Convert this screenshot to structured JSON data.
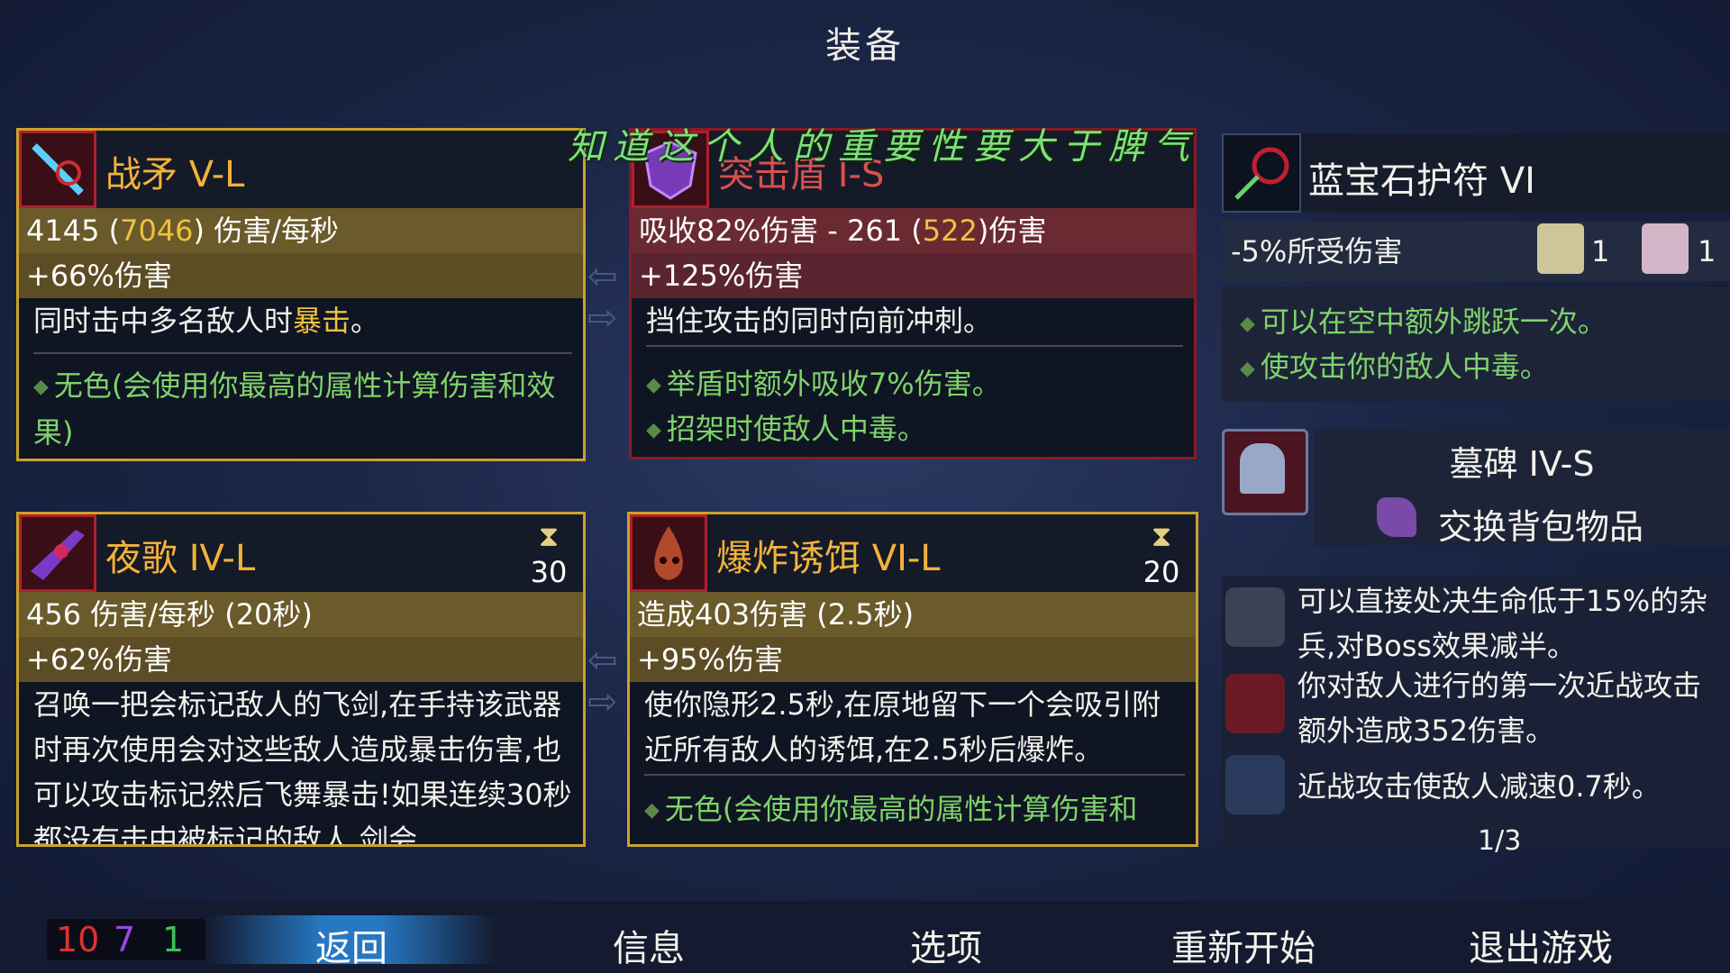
{
  "screen_title": "装备",
  "overlay_text": "知道这个人的重要性要大于脾气",
  "weapons": [
    {
      "name": "战矛 V-L",
      "stat1_a": "4145 (",
      "stat1_b": "7046",
      "stat1_c": ") 伤害/每秒",
      "stat2": "+66%伤害",
      "desc_a": "同时击中多名敌人时",
      "desc_b": "暴击",
      "desc_c": "。",
      "bonus": "无色(会使用你最高的属性计算伤害和效果)"
    },
    {
      "name": "突击盾 I-S",
      "stat1_a": "吸收82%伤害 - 261 (",
      "stat1_b": "522",
      "stat1_c": ")伤害",
      "stat2": "+125%伤害",
      "desc": "挡住攻击的同时向前冲刺。",
      "bonus1": "举盾时额外吸收7%伤害。",
      "bonus2": "招架时使敌人中毒。"
    }
  ],
  "skills": [
    {
      "name": "夜歌 IV-L",
      "cooldown": "30",
      "stat1": "456 伤害/每秒 (20秒)",
      "stat2": "+62%伤害",
      "desc": "召唤一把会标记敌人的飞剑,在手持该武器时再次使用会对这些敌人造成暴击伤害,也可以攻击标记然后飞舞暴击!如果连续30秒都没有击中被标记的敌人,剑会"
    },
    {
      "name": "爆炸诱饵 VI-L",
      "cooldown": "20",
      "stat1": "造成403伤害 (2.5秒)",
      "stat2": "+95%伤害",
      "desc": "使你隐形2.5秒,在原地留下一个会吸引附近所有敌人的诱饵,在2.5秒后爆炸。",
      "bonus": "无色(会使用你最高的属性计算伤害和"
    }
  ],
  "amulet": {
    "name": "蓝宝石护符 VI",
    "sub": "-5%所受伤害",
    "scroll1_count": "1",
    "scroll2_count": "1",
    "effects": [
      "可以在空中额外跳跃一次。",
      "使攻击你的敌人中毒。"
    ]
  },
  "backpack": {
    "name": "墓碑 IV-S",
    "action": "交换背包物品"
  },
  "mutations": [
    {
      "text": "可以直接处决生命低于15%的杂兵,对Boss效果减半。"
    },
    {
      "text": "你对敌人进行的第一次近战攻击额外造成352伤害。"
    },
    {
      "text": "近战攻击使敌人减速0.7秒。"
    }
  ],
  "mutation_count": "1/3",
  "resources": {
    "red": "10",
    "purple": "7",
    "green": "1"
  },
  "nav": {
    "back": "返回",
    "info": "信息",
    "options": "选项",
    "restart": "重新开始",
    "quit": "退出游戏"
  },
  "colors": {
    "gold": "#c9a22c",
    "red_border": "#8a1a24",
    "stat_gold": "#6b5a2a",
    "green_text": "#7fd36a",
    "highlight": "#f0c13e"
  }
}
